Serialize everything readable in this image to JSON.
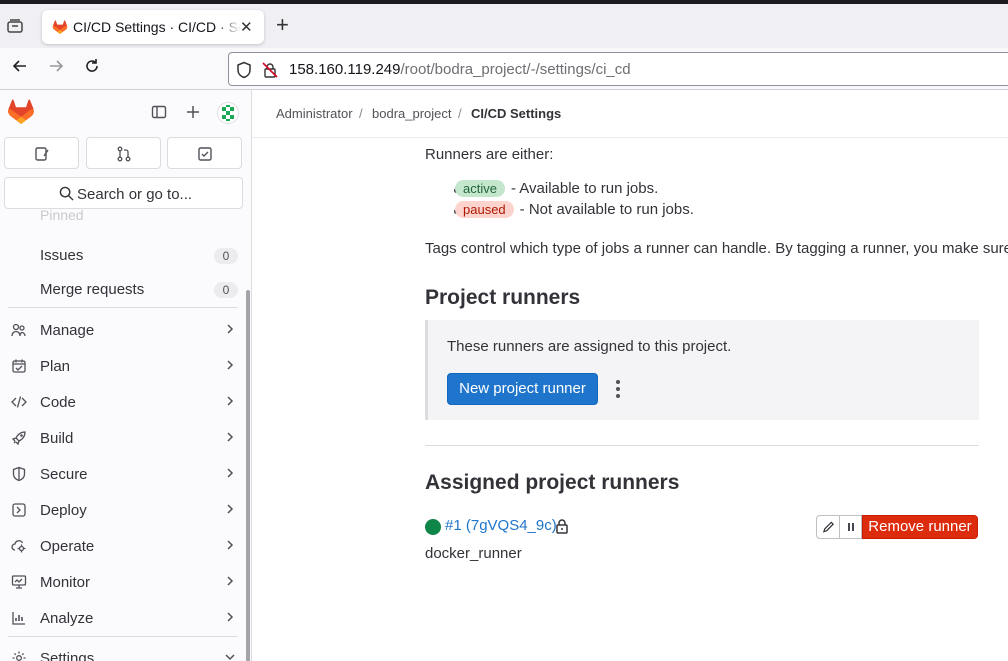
{
  "browser": {
    "tab_title": "CI/CD Settings · CI/CD · Se",
    "close_glyph": "✕",
    "new_tab_glyph": "+",
    "url_host": "158.160.119.249",
    "url_path": "/root/bodra_project/-/settings/ci_cd"
  },
  "sidebar": {
    "search_label": "Search or go to...",
    "pinned_label": "Pinned",
    "items": [
      {
        "label": "Issues",
        "count": "0",
        "icon": "none"
      },
      {
        "label": "Merge requests",
        "count": "0",
        "icon": "none"
      },
      {
        "label": "Manage",
        "icon": "users-icon"
      },
      {
        "label": "Plan",
        "icon": "calendar-icon"
      },
      {
        "label": "Code",
        "icon": "code-icon"
      },
      {
        "label": "Build",
        "icon": "rocket-icon"
      },
      {
        "label": "Secure",
        "icon": "shield-icon"
      },
      {
        "label": "Deploy",
        "icon": "deploy-icon"
      },
      {
        "label": "Operate",
        "icon": "cloud-gear-icon"
      },
      {
        "label": "Monitor",
        "icon": "monitor-icon"
      },
      {
        "label": "Analyze",
        "icon": "chart-icon"
      },
      {
        "label": "Settings",
        "icon": "gear-icon"
      }
    ]
  },
  "breadcrumb": {
    "items": [
      "Administrator",
      "bodra_project",
      "CI/CD Settings"
    ],
    "separator": "/"
  },
  "content": {
    "runners_intro": "Runners are either:",
    "status_active_badge": "active",
    "status_active_desc": "- Available to run jobs.",
    "status_paused_badge": "paused",
    "status_paused_desc": "- Not available to run jobs.",
    "tags_text": "Tags control which type of jobs a runner can handle. By tagging a runner, you make sure",
    "project_runners_heading": "Project runners",
    "callout_text": "These runners are assigned to this project.",
    "new_runner_button": "New project runner",
    "assigned_heading": "Assigned project runners",
    "runner": {
      "link_text": "#1 (7gVQS4_9c)",
      "tag": "docker_runner",
      "status_color": "#108548",
      "remove_button": "Remove runner"
    }
  },
  "colors": {
    "primary": "#1f75cb",
    "danger": "#dd2b0e",
    "success": "#108548"
  }
}
